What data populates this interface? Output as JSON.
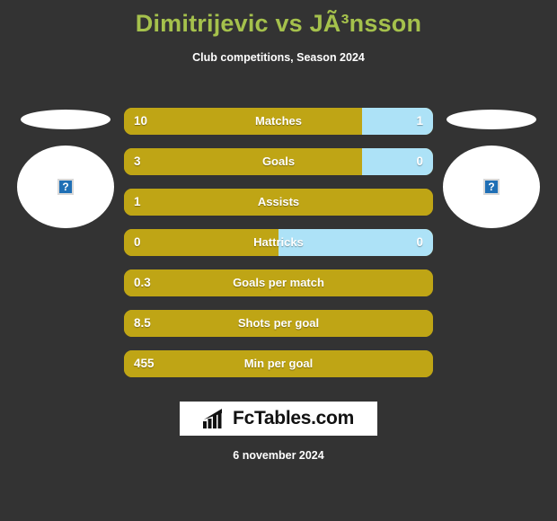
{
  "header": {
    "title": "Dimitrijevic vs JÃ³nsson",
    "subtitle": "Club competitions, Season 2024"
  },
  "players": {
    "left": {
      "flag_icon": "flag-placeholder-icon",
      "photo_icon": "broken-image-icon",
      "photo_glyph": "?"
    },
    "right": {
      "flag_icon": "flag-placeholder-icon",
      "photo_icon": "broken-image-icon",
      "photo_glyph": "?"
    }
  },
  "logo": {
    "text": "FcTables.com",
    "icon": "bar-chart-arrow-icon"
  },
  "footer": {
    "date": "6 november 2024"
  },
  "colors": {
    "background": "#333333",
    "title": "#a5c14c",
    "left_bar": "#bfa515",
    "right_bar": "#ade2f7",
    "logo_background": "#ffffff"
  },
  "chart_data": {
    "type": "bar",
    "title": "Dimitrijevic vs JÃ³nsson",
    "subtitle": "Club competitions, Season 2024",
    "orientation": "horizontal-diverging",
    "series": [
      {
        "name": "Dimitrijevic",
        "color": "#bfa515",
        "side": "left"
      },
      {
        "name": "JÃ³nsson",
        "color": "#ade2f7",
        "side": "right"
      }
    ],
    "categories": [
      "Matches",
      "Goals",
      "Assists",
      "Hattricks",
      "Goals per match",
      "Shots per goal",
      "Min per goal"
    ],
    "rows": [
      {
        "label": "Matches",
        "left_value": "10",
        "right_value": "1",
        "left_pct": 77,
        "right_pct": 23,
        "has_right": true
      },
      {
        "label": "Goals",
        "left_value": "3",
        "right_value": "0",
        "left_pct": 77,
        "right_pct": 23,
        "has_right": true
      },
      {
        "label": "Assists",
        "left_value": "1",
        "right_value": "",
        "left_pct": 100,
        "right_pct": 0,
        "has_right": false
      },
      {
        "label": "Hattricks",
        "left_value": "0",
        "right_value": "0",
        "left_pct": 50,
        "right_pct": 50,
        "has_right": true
      },
      {
        "label": "Goals per match",
        "left_value": "0.3",
        "right_value": "",
        "left_pct": 100,
        "right_pct": 0,
        "has_right": false
      },
      {
        "label": "Shots per goal",
        "left_value": "8.5",
        "right_value": "",
        "left_pct": 100,
        "right_pct": 0,
        "has_right": false
      },
      {
        "label": "Min per goal",
        "left_value": "455",
        "right_value": "",
        "left_pct": 100,
        "right_pct": 0,
        "has_right": false
      }
    ]
  }
}
